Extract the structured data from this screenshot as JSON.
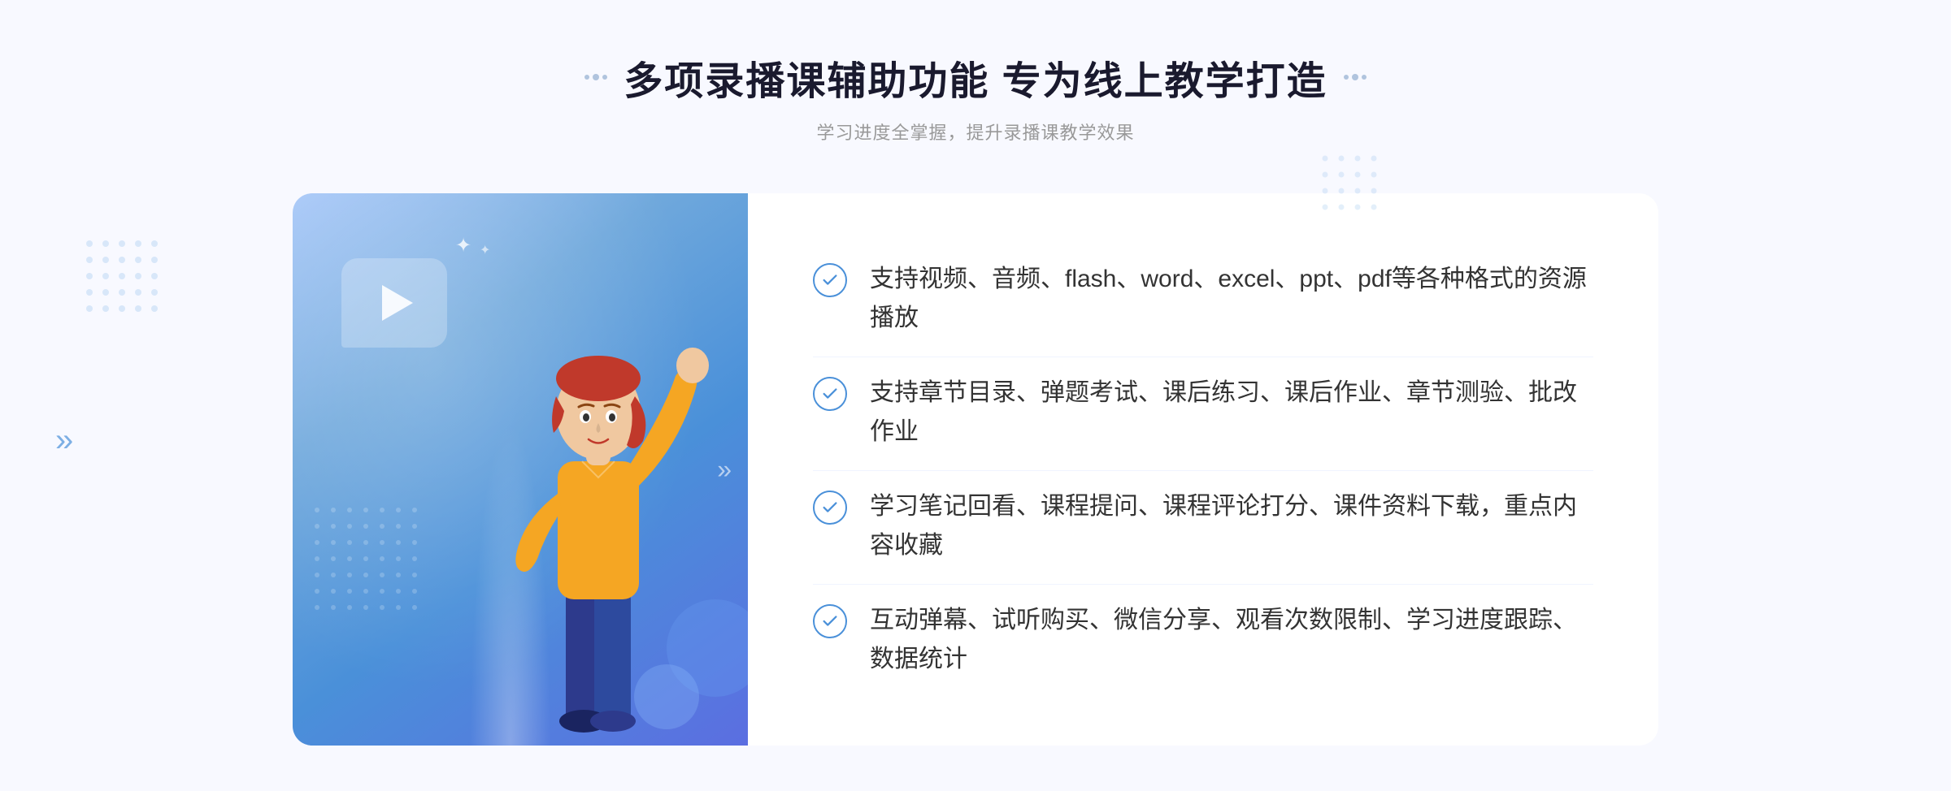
{
  "page": {
    "background": "#f0f4ff"
  },
  "header": {
    "title": "多项录播课辅助功能 专为线上教学打造",
    "subtitle": "学习进度全掌握，提升录播课教学效果",
    "title_decorator_left": "decorators",
    "title_decorator_right": "decorators"
  },
  "features": [
    {
      "id": 1,
      "text": "支持视频、音频、flash、word、excel、ppt、pdf等各种格式的资源播放"
    },
    {
      "id": 2,
      "text": "支持章节目录、弹题考试、课后练习、课后作业、章节测验、批改作业"
    },
    {
      "id": 3,
      "text": "学习笔记回看、课程提问、课程评论打分、课件资料下载，重点内容收藏"
    },
    {
      "id": 4,
      "text": "互动弹幕、试听购买、微信分享、观看次数限制、学习进度跟踪、数据统计"
    }
  ],
  "illustration": {
    "play_icon": "▶",
    "arrow": "»"
  },
  "colors": {
    "primary_blue": "#4a90d9",
    "light_blue": "#a8d4f8",
    "dark_text": "#1a1a2e",
    "medium_text": "#333333",
    "light_text": "#999999",
    "panel_bg": "#ffffff",
    "page_bg": "#f5f7ff"
  }
}
